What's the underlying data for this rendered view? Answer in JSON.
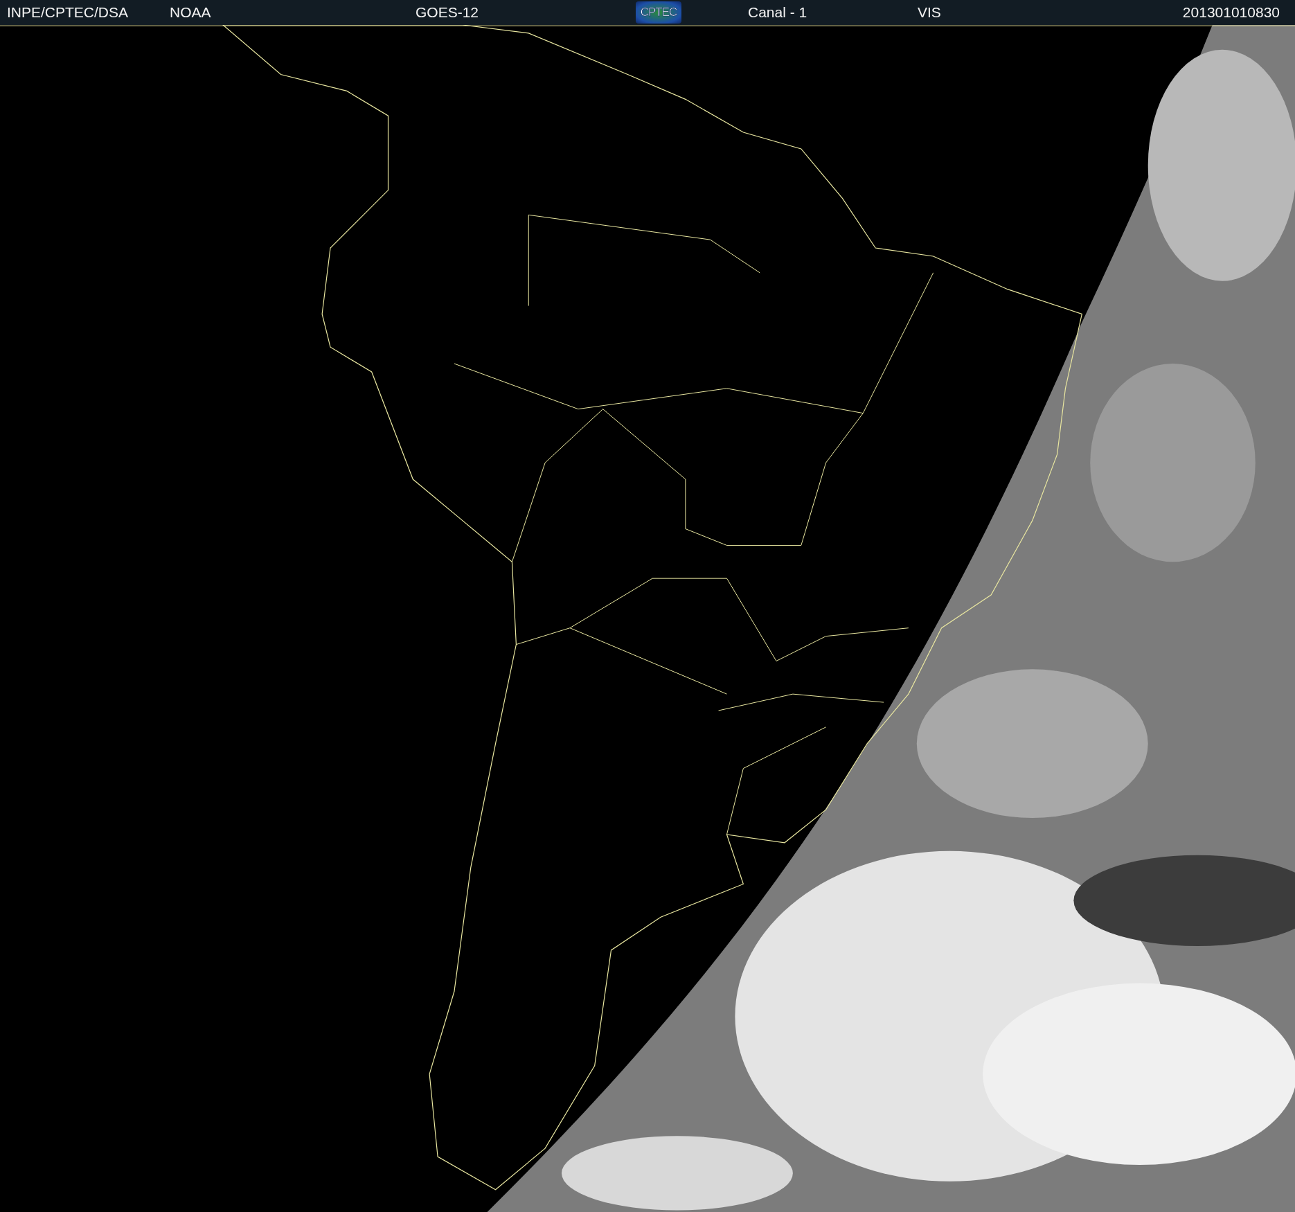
{
  "header": {
    "items": [
      "INPE/CPTEC/DSA",
      "NOAA",
      "GOES-12"
    ],
    "logo": {
      "text": "CPTEC"
    },
    "channel": "Canal - 1",
    "band": "VIS",
    "timestamp": "201301010830"
  }
}
